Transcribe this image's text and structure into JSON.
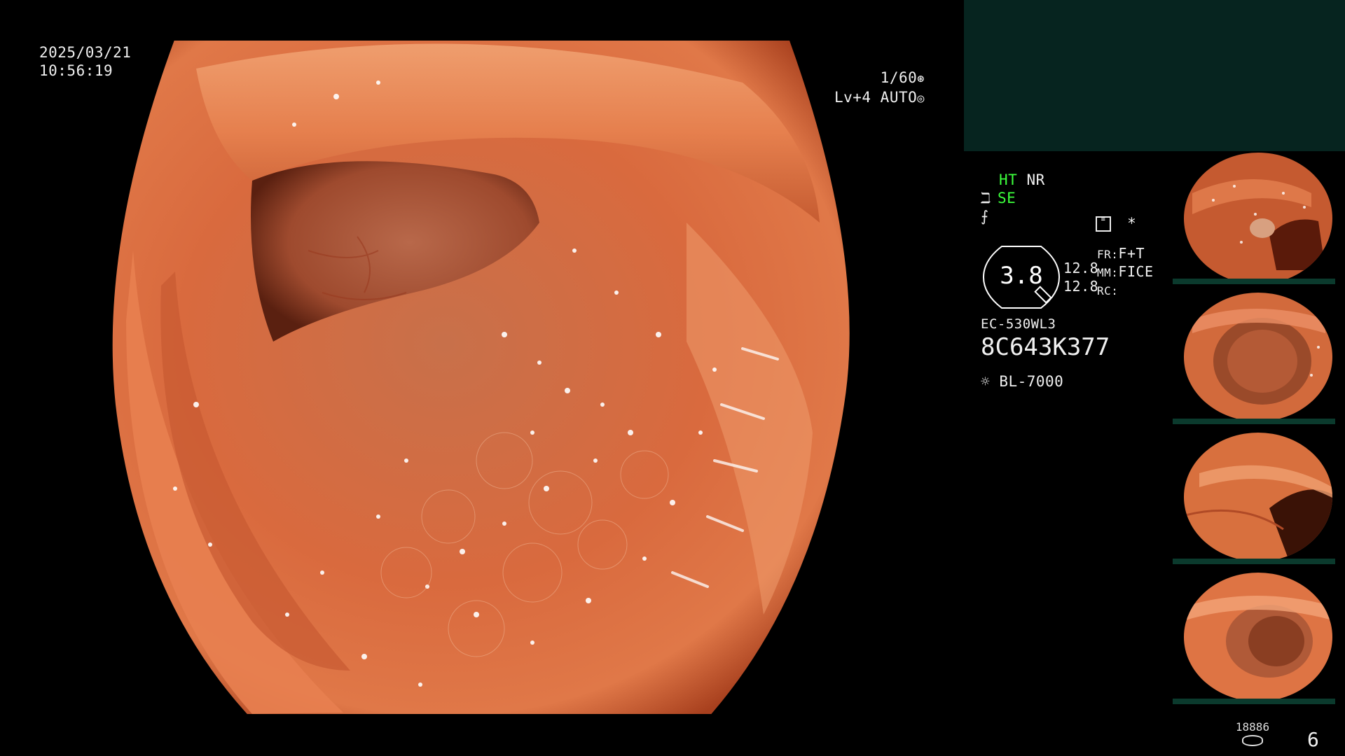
{
  "header": {
    "date": "2025/03/21",
    "time": "10:56:19"
  },
  "exposure": {
    "shutter": "1/60",
    "level": "Lv+4",
    "mode": "AUTO"
  },
  "settings": {
    "ht": "HT",
    "nr": "NR",
    "se": "SE",
    "zoom_value": "3.8",
    "mag_top": "12.8",
    "mag_bottom": "12.8",
    "fr_label": "FR:",
    "fr_value": "F+T",
    "mm_label": "MM:",
    "mm_value": "FICE",
    "rc_label": "RC:",
    "scope_model": "EC-530WL3",
    "serial": "8C643K377",
    "light_source": "BL-7000",
    "asterisk": "*"
  },
  "footer": {
    "image_count": "18886",
    "page_number": "6"
  },
  "thumbnails": [
    {
      "index": 1
    },
    {
      "index": 2
    },
    {
      "index": 3
    },
    {
      "index": 4
    }
  ],
  "colors": {
    "accent_green": "#3cff3c",
    "panel_dark_green": "#06241f",
    "tissue_orange": "#d9643a"
  },
  "icons": {
    "shutter": "shutter-icon",
    "auto": "auto-iris-icon",
    "structure": "structure-enhance-icon",
    "flash": "freeze-icon",
    "memo": "memo-icon",
    "light": "light-source-icon",
    "storage": "storage-icon"
  }
}
